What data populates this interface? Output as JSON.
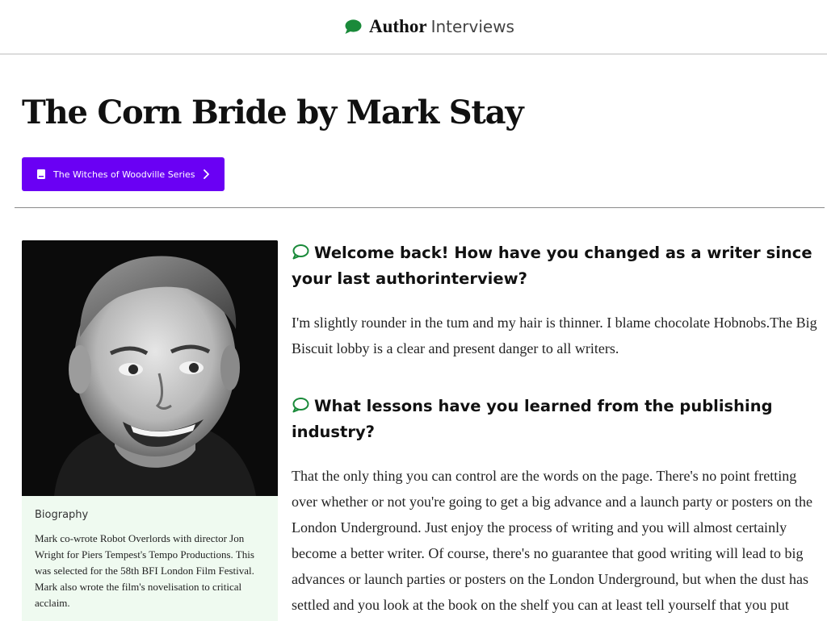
{
  "header": {
    "brand_strong": "Author",
    "brand_light": "Interviews"
  },
  "page": {
    "title": "The Corn Bride by Mark Stay",
    "series_button": "The Witches of Woodville Series"
  },
  "bio": {
    "title": "Biography",
    "text": "Mark co-wrote Robot Overlords with director Jon Wright for Piers Tempest's Tempo Productions. This was selected for the 58th BFI London Film Festival. Mark also wrote the film's novelisation to critical acclaim."
  },
  "qa": [
    {
      "question": "Welcome back! How have you changed as a writer since your last authorinterview?",
      "answer": "I'm slightly rounder in the tum and my hair is thinner. I blame chocolate Hobnobs.The Big Biscuit lobby is a clear and present danger to all writers."
    },
    {
      "question": "What lessons have you learned from the publishing industry?",
      "answer": "That the only thing you can control are the words on the page. There's no point fretting over whether or not you're going to get a big advance and a launch party or posters on the London Underground. Just enjoy the process of writing and you will almost certainly become a better writer. Of course, there's no guarantee that good writing will lead to big advances or launch parties or posters on the London Underground, but when the dust has settled and you look at the book on the shelf you can at least tell yourself that you put everything on the page."
    }
  ],
  "colors": {
    "accent_green": "#1a8a3a",
    "button_purple": "#6a00f4",
    "bio_background": "#effaf0"
  },
  "icons": {
    "brand": "speech-bubble-icon",
    "question": "speech-bubble-outline-icon",
    "button": "book-icon",
    "button_arrow": "chevron-right-icon"
  }
}
